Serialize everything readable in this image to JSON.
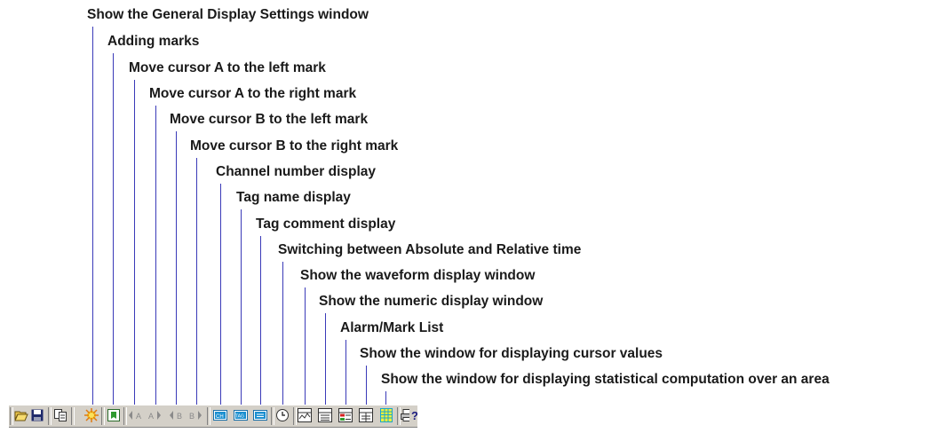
{
  "callouts": [
    {
      "id": "general-display-settings",
      "label": "Show the General Display Settings window"
    },
    {
      "id": "adding-marks",
      "label": "Adding marks"
    },
    {
      "id": "cursor-a-left",
      "label": "Move cursor A to the left mark"
    },
    {
      "id": "cursor-a-right",
      "label": "Move cursor A to the right mark"
    },
    {
      "id": "cursor-b-left",
      "label": "Move cursor B to the left mark"
    },
    {
      "id": "cursor-b-right",
      "label": "Move cursor B to the right mark"
    },
    {
      "id": "channel-number",
      "label": "Channel number display"
    },
    {
      "id": "tag-name",
      "label": "Tag name display"
    },
    {
      "id": "tag-comment",
      "label": "Tag comment display"
    },
    {
      "id": "abs-rel-time",
      "label": "Switching between Absolute and Relative time"
    },
    {
      "id": "waveform-window",
      "label": "Show the waveform display window"
    },
    {
      "id": "numeric-window",
      "label": "Show the numeric display window"
    },
    {
      "id": "alarm-mark-list",
      "label": "Alarm/Mark List"
    },
    {
      "id": "cursor-values-window",
      "label": "Show the window for displaying cursor values"
    },
    {
      "id": "statistics-window",
      "label": "Show the window for displaying statistical computation over an area"
    }
  ],
  "toolbar": {
    "buttons": [
      {
        "id": "open",
        "icon": "open-folder-icon"
      },
      {
        "id": "save",
        "icon": "save-disk-icon"
      },
      {
        "id": "copy",
        "icon": "copy-icon"
      },
      {
        "id": "general-display-settings",
        "icon": "display-settings-icon"
      },
      {
        "id": "adding-marks",
        "icon": "add-mark-icon"
      },
      {
        "id": "cursor-a-left",
        "icon": "cursor-a-left-icon",
        "text": "A"
      },
      {
        "id": "cursor-a-right",
        "icon": "cursor-a-right-icon",
        "text": "A"
      },
      {
        "id": "cursor-b-left",
        "icon": "cursor-b-left-icon",
        "text": "B"
      },
      {
        "id": "cursor-b-right",
        "icon": "cursor-b-right-icon",
        "text": "B"
      },
      {
        "id": "channel-number",
        "icon": "channel-number-icon",
        "text": "CH"
      },
      {
        "id": "tag-name",
        "icon": "tag-name-icon",
        "text": "TAG"
      },
      {
        "id": "tag-comment",
        "icon": "tag-comment-icon"
      },
      {
        "id": "abs-rel-time",
        "icon": "clock-icon"
      },
      {
        "id": "waveform-window",
        "icon": "waveform-icon"
      },
      {
        "id": "numeric-window",
        "icon": "numeric-icon"
      },
      {
        "id": "alarm-mark-list",
        "icon": "alarm-list-icon"
      },
      {
        "id": "cursor-values-window",
        "icon": "cursor-values-icon"
      },
      {
        "id": "statistics-window",
        "icon": "statistics-icon"
      },
      {
        "id": "print",
        "icon": "print-icon"
      },
      {
        "id": "help",
        "icon": "help-icon"
      }
    ]
  }
}
